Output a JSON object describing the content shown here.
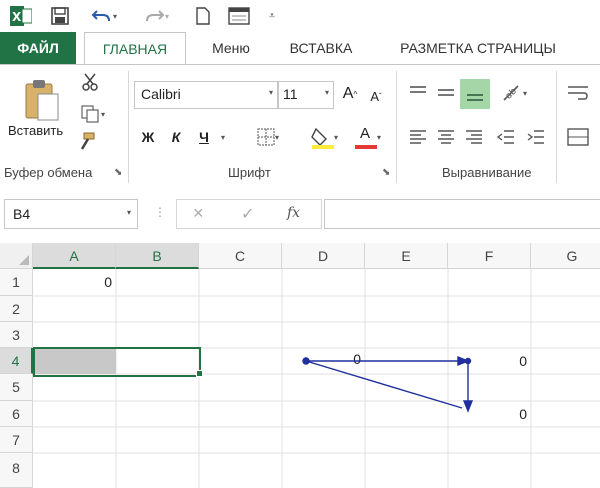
{
  "tabs": {
    "file": "ФАЙЛ",
    "home": "ГЛАВНАЯ",
    "menu": "Меню",
    "insert": "ВСТАВКА",
    "page_layout": "РАЗМЕТКА СТРАНИЦЫ"
  },
  "ribbon": {
    "clipboard": {
      "paste_label": "Вставить",
      "group_label": "Буфер обмена"
    },
    "font": {
      "font_name": "Calibri",
      "font_size": "11",
      "bold": "Ж",
      "italic": "К",
      "underline": "Ч",
      "grow": "A",
      "shrink": "A",
      "color_letter": "A",
      "group_label": "Шрифт"
    },
    "alignment": {
      "group_label": "Выравнивание"
    }
  },
  "formula_bar": {
    "name_box": "B4",
    "cancel": "×",
    "confirm": "✓",
    "fx": "fx",
    "value": ""
  },
  "grid": {
    "columns": [
      "A",
      "B",
      "C",
      "D",
      "E",
      "F",
      "G"
    ],
    "rows": [
      "1",
      "2",
      "3",
      "4",
      "5",
      "6",
      "7",
      "8"
    ],
    "cells": {
      "A1": "0",
      "D4": "0",
      "F4": "0",
      "F6": "0"
    }
  },
  "colors": {
    "accent": "#217346",
    "trace_arrow": "#1f2f9c",
    "highlight": "#a5d6a7"
  }
}
